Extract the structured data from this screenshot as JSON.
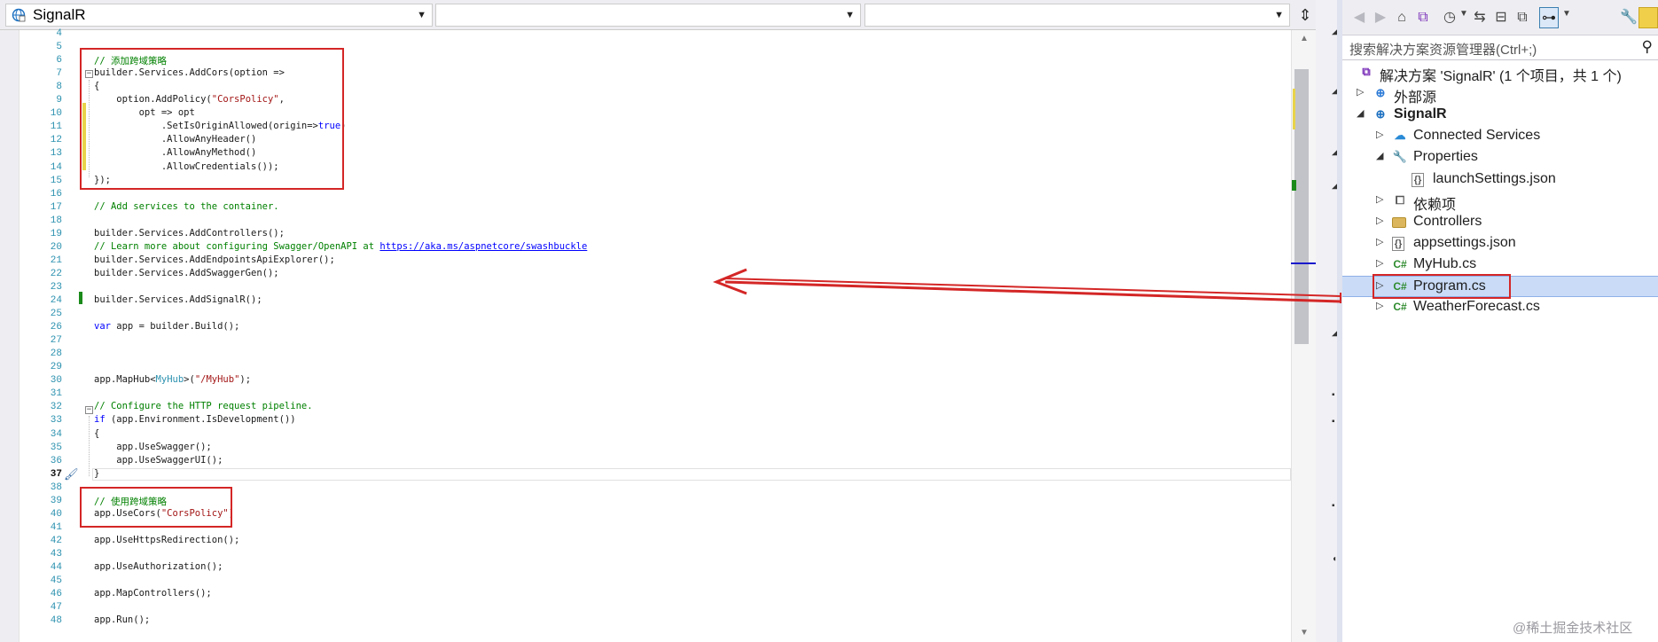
{
  "editor": {
    "nav": {
      "project_dropdown": "SignalR",
      "type_dropdown": "",
      "member_dropdown": ""
    },
    "current_line": "37",
    "lines": [
      {
        "n": "4",
        "t": ""
      },
      {
        "n": "5",
        "t": ""
      },
      {
        "n": "6",
        "t": "// 添加跨域策略"
      },
      {
        "n": "7",
        "t": "builder.Services.AddCors(option =>"
      },
      {
        "n": "8",
        "t": "{"
      },
      {
        "n": "9",
        "t": "    option.AddPolicy(\"CorsPolicy\","
      },
      {
        "n": "10",
        "t": "        opt => opt"
      },
      {
        "n": "11",
        "t": "            .SetIsOriginAllowed(origin=>true)"
      },
      {
        "n": "12",
        "t": "            .AllowAnyHeader()"
      },
      {
        "n": "13",
        "t": "            .AllowAnyMethod()"
      },
      {
        "n": "14",
        "t": "            .AllowCredentials());"
      },
      {
        "n": "15",
        "t": "});"
      },
      {
        "n": "16",
        "t": ""
      },
      {
        "n": "17",
        "t": "// Add services to the container."
      },
      {
        "n": "18",
        "t": ""
      },
      {
        "n": "19",
        "t": "builder.Services.AddControllers();"
      },
      {
        "n": "20",
        "t": "// Learn more about configuring Swagger/OpenAPI at https://aka.ms/aspnetcore/swashbuckle"
      },
      {
        "n": "21",
        "t": "builder.Services.AddEndpointsApiExplorer();"
      },
      {
        "n": "22",
        "t": "builder.Services.AddSwaggerGen();"
      },
      {
        "n": "23",
        "t": ""
      },
      {
        "n": "24",
        "t": "builder.Services.AddSignalR();"
      },
      {
        "n": "25",
        "t": ""
      },
      {
        "n": "26",
        "t": "var app = builder.Build();"
      },
      {
        "n": "27",
        "t": ""
      },
      {
        "n": "28",
        "t": ""
      },
      {
        "n": "29",
        "t": ""
      },
      {
        "n": "30",
        "t": "app.MapHub<MyHub>(\"/MyHub\");"
      },
      {
        "n": "31",
        "t": ""
      },
      {
        "n": "32",
        "t": "// Configure the HTTP request pipeline."
      },
      {
        "n": "33",
        "t": "if (app.Environment.IsDevelopment())"
      },
      {
        "n": "34",
        "t": "{"
      },
      {
        "n": "35",
        "t": "    app.UseSwagger();"
      },
      {
        "n": "36",
        "t": "    app.UseSwaggerUI();"
      },
      {
        "n": "37",
        "t": "}"
      },
      {
        "n": "38",
        "t": ""
      },
      {
        "n": "39",
        "t": "// 使用跨域策略"
      },
      {
        "n": "40",
        "t": "app.UseCors(\"CorsPolicy\")"
      },
      {
        "n": "41",
        "t": ""
      },
      {
        "n": "42",
        "t": "app.UseHttpsRedirection();"
      },
      {
        "n": "43",
        "t": ""
      },
      {
        "n": "44",
        "t": "app.UseAuthorization();"
      },
      {
        "n": "45",
        "t": ""
      },
      {
        "n": "46",
        "t": "app.MapControllers();"
      },
      {
        "n": "47",
        "t": ""
      },
      {
        "n": "48",
        "t": "app.Run();"
      }
    ]
  },
  "solution_explorer": {
    "search_placeholder": "搜索解决方案资源管理器(Ctrl+;)",
    "toolbar_icons": [
      "back-icon",
      "forward-icon",
      "home-icon",
      "vs-switch-icon",
      "history-icon",
      "sync-icon",
      "collapse-icon",
      "copy-icon",
      "filter-icon",
      "wrench-icon",
      "pin-icon"
    ],
    "tree": [
      {
        "label": "解决方案 'SignalR' (1 个项目，共 1 个)",
        "icon": "solution-icon",
        "depth": 0,
        "expander": ""
      },
      {
        "label": "外部源",
        "icon": "external-sources-icon",
        "depth": 0,
        "expander": "collapsed"
      },
      {
        "label": "SignalR",
        "icon": "web-project-icon",
        "depth": 0,
        "expander": "expanded",
        "bold": true
      },
      {
        "label": "Connected Services",
        "icon": "cloud-icon",
        "depth": 1,
        "expander": "collapsed"
      },
      {
        "label": "Properties",
        "icon": "wrench-icon",
        "depth": 1,
        "expander": "expanded"
      },
      {
        "label": "launchSettings.json",
        "icon": "json-file-icon",
        "depth": 2,
        "expander": ""
      },
      {
        "label": "依赖项",
        "icon": "dependencies-icon",
        "depth": 1,
        "expander": "collapsed"
      },
      {
        "label": "Controllers",
        "icon": "folder-icon",
        "depth": 1,
        "expander": "collapsed"
      },
      {
        "label": "appsettings.json",
        "icon": "json-file-icon",
        "depth": 1,
        "expander": "collapsed"
      },
      {
        "label": "MyHub.cs",
        "icon": "csharp-file-icon",
        "depth": 1,
        "expander": "collapsed"
      },
      {
        "label": "Program.cs",
        "icon": "csharp-file-icon",
        "depth": 1,
        "expander": "collapsed",
        "selected": true
      },
      {
        "label": "WeatherForecast.cs",
        "icon": "csharp-file-icon",
        "depth": 1,
        "expander": "collapsed"
      }
    ]
  },
  "icon_glyphs": {
    "csharp": "C#",
    "json": "{}"
  },
  "watermark": "@稀土掘金技术社区",
  "colors": {
    "highlight_red": "#d42626",
    "selection_bg": "#c9dbf7",
    "comment_green": "#008000",
    "keyword_blue": "#0000ff",
    "string_red": "#a31515"
  }
}
